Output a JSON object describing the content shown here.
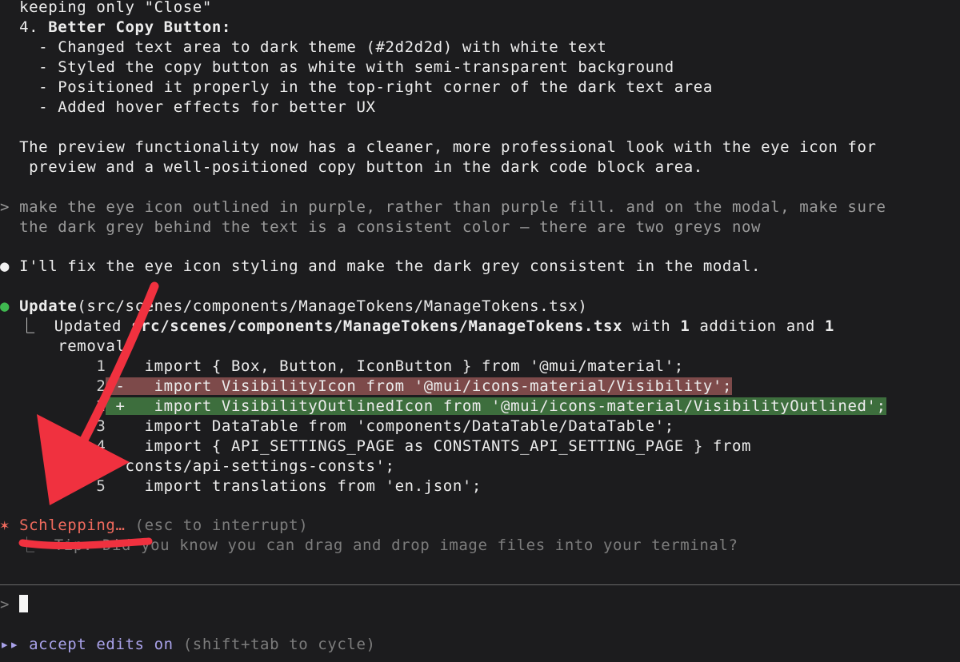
{
  "transcript": {
    "lines": [
      "  keeping only \"Close\"",
      "  4. ",
      "Better Copy Button:",
      "    - Changed text area to dark theme (#2d2d2d) with white text",
      "    - Styled the copy button as white with semi-transparent background",
      "    - Positioned it properly in the top-right corner of the dark text area",
      "    - Added hover effects for better UX",
      "  The preview functionality now has a cleaner, more professional look with the eye icon for",
      "   preview and a well-positioned copy button in the dark code block area."
    ]
  },
  "user_prompt": {
    "marker": ">",
    "line1": " make the eye icon outlined in purple, rather than purple fill. and on the modal, make sure",
    "line2": "  the dark grey behind the text is a consistent color – there are two greys now"
  },
  "assistant_reply": {
    "bullet": "●",
    "text": " I'll fix the eye icon styling and make the dark grey consistent in the modal."
  },
  "tool_call": {
    "bullet": "●",
    "name": "Update",
    "args": "(src/scenes/components/ManageTokens/ManageTokens.tsx)",
    "result_prefix": "  ⎿  Updated ",
    "result_path": "src/scenes/components/ManageTokens/ManageTokens.tsx",
    "result_mid1": " with ",
    "additions": "1",
    "result_mid2": " addition and ",
    "removals": "1",
    "result_wrap": "      removal"
  },
  "diff": {
    "lines": [
      {
        "num": "1",
        "sign": " ",
        "code": "   import { Box, Button, IconButton } from '@mui/material';"
      },
      {
        "num": "2",
        "sign": "-",
        "code": "   import VisibilityIcon from '@mui/icons-material/Visibility';"
      },
      {
        "num": "2",
        "sign": "+",
        "code": "   import VisibilityOutlinedIcon from '@mui/icons-material/VisibilityOutlined';"
      },
      {
        "num": "3",
        "sign": " ",
        "code": "   import DataTable from 'components/DataTable/DataTable';"
      },
      {
        "num": "4",
        "sign": " ",
        "code": "   import { API_SETTINGS_PAGE as CONSTANTS_API_SETTING_PAGE } from"
      },
      {
        "num": "",
        "sign": "",
        "code": "            'consts/api-settings-consts';"
      },
      {
        "num": "5",
        "sign": " ",
        "code": "   import translations from 'en.json';"
      }
    ]
  },
  "status": {
    "spinner": "✶",
    "verb": " Schlepping…",
    "hint": " (esc to interrupt)",
    "tip": "  ⎿  Tip: Did you know you can drag and drop image files into your terminal?"
  },
  "input": {
    "prompt": ">",
    "value": ""
  },
  "footer": {
    "icon": "▸▸",
    "mode": " accept edits on",
    "hint": " (shift+tab to cycle)"
  },
  "annotation_color": "#f0313f"
}
